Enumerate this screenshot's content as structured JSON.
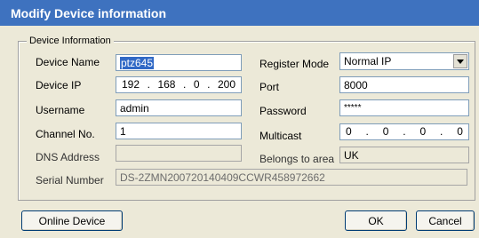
{
  "window": {
    "title": "Modify Device information"
  },
  "group": {
    "legend": "Device Information"
  },
  "labels": {
    "device_name": "Device Name",
    "device_ip": "Device IP",
    "username": "Username",
    "channel_no": "Channel No.",
    "dns_address": "DNS Address",
    "serial_number": "Serial Number",
    "register_mode": "Register Mode",
    "port": "Port",
    "password": "Password",
    "multicast": "Multicast",
    "belongs_to_area": "Belongs to area"
  },
  "values": {
    "device_name": "ptz645",
    "device_ip": [
      "192",
      "168",
      "0",
      "200"
    ],
    "username": "admin",
    "channel_no": "1",
    "dns_address": "",
    "serial_number": "DS-2ZMN200720140409CCWR458972662",
    "register_mode": "Normal IP",
    "port": "8000",
    "password": "*****",
    "multicast": [
      "0",
      "0",
      "0",
      "0"
    ],
    "belongs_to_area": "UK"
  },
  "buttons": {
    "online_device": "Online Device",
    "ok": "OK",
    "cancel": "Cancel"
  },
  "icons": {
    "dropdown": "chevron-down-icon"
  },
  "colors": {
    "titlebar": "#3e72bf",
    "selection": "#3169c6"
  }
}
